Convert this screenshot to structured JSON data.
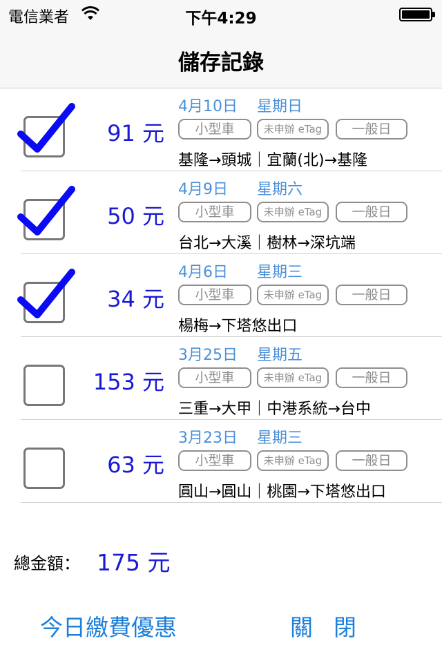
{
  "status_bar": {
    "carrier": "電信業者",
    "time": "下午4:29",
    "wifi_icon": "wifi-icon",
    "battery_icon": "battery-icon"
  },
  "nav": {
    "title": "儲存記錄"
  },
  "colors": {
    "amount": "#1a1ad6",
    "date": "#4a90d9",
    "tag": "#8e8e8e",
    "checkmark": "#0a0af5",
    "button": "#1e7fd9"
  },
  "records": [
    {
      "checked": true,
      "amount": "91 元",
      "date": "4月10日",
      "weekday": "星期日",
      "vehicle": "小型車",
      "etag": "未申辦 eTag",
      "day_type": "一般日",
      "route": "基隆→頭城｜宜蘭(北)→基隆"
    },
    {
      "checked": true,
      "amount": "50 元",
      "date": "4月9日",
      "weekday": "星期六",
      "vehicle": "小型車",
      "etag": "未申辦 eTag",
      "day_type": "一般日",
      "route": "台北→大溪｜樹林→深坑端"
    },
    {
      "checked": true,
      "amount": "34 元",
      "date": "4月6日",
      "weekday": "星期三",
      "vehicle": "小型車",
      "etag": "未申辦 eTag",
      "day_type": "一般日",
      "route": "楊梅→下塔悠出口"
    },
    {
      "checked": false,
      "amount": "153 元",
      "date": "3月25日",
      "weekday": "星期五",
      "vehicle": "小型車",
      "etag": "未申辦 eTag",
      "day_type": "一般日",
      "route": "三重→大甲｜中港系統→台中"
    },
    {
      "checked": false,
      "amount": "63 元",
      "date": "3月23日",
      "weekday": "星期三",
      "vehicle": "小型車",
      "etag": "未申辦 eTag",
      "day_type": "一般日",
      "route": "圓山→圓山｜桃園→下塔悠出口"
    }
  ],
  "summary": {
    "total_label": "總金額：",
    "total_value": "175 元"
  },
  "buttons": {
    "discount": "今日繳費優惠",
    "close": "關閉"
  }
}
